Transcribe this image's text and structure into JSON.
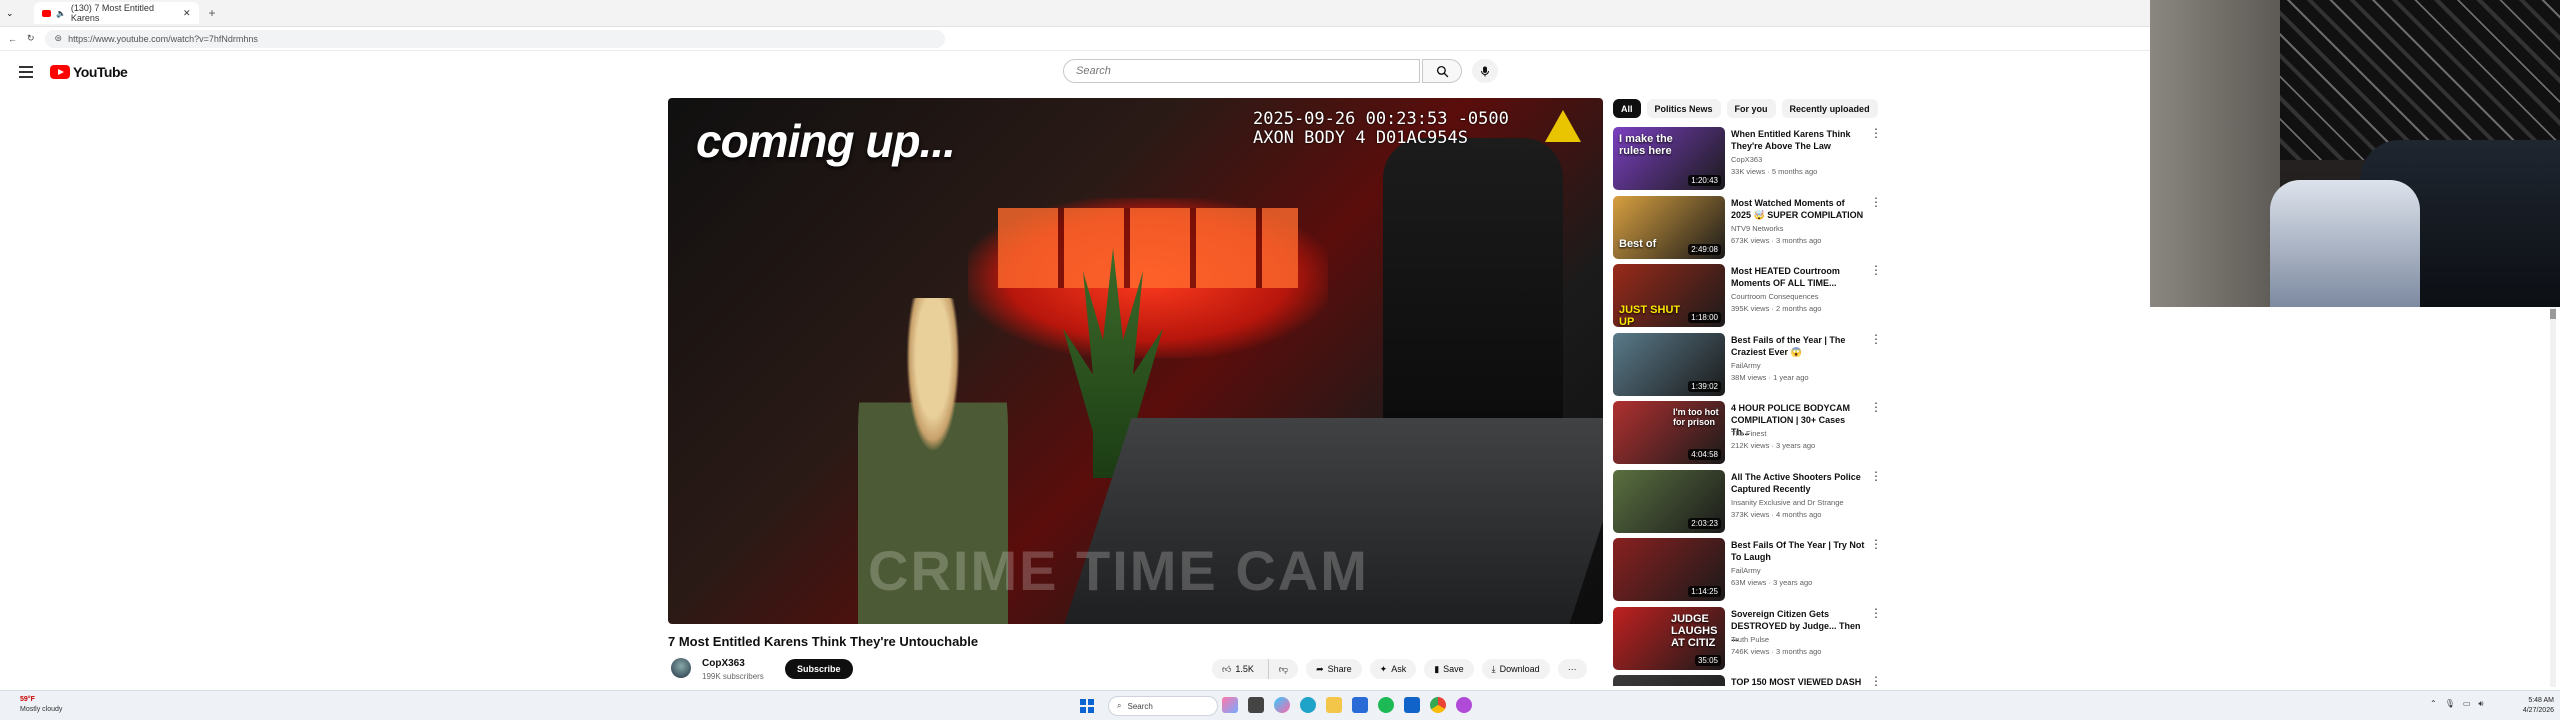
{
  "browser": {
    "tab_title": "(130) 7 Most Entitled Karens",
    "new_tab": "+",
    "url": "https://www.youtube.com/watch?v=7hfNdrmhns"
  },
  "youtube": {
    "logo_text": "YouTube",
    "search_placeholder": "Search"
  },
  "video": {
    "overlay_text": "coming up...",
    "timestamp_line1": "2025-09-26 00:23:53 -0500",
    "timestamp_line2": "AXON BODY 4 D01AC954S",
    "watermark": "CRIME TIME CAM",
    "title": "7 Most Entitled Karens Think They're Untouchable",
    "channel_name": "CopX363",
    "channel_subs": "199K subscribers",
    "subscribe_label": "Subscribe",
    "like_count": "1.5K",
    "share_label": "Share",
    "ask_label": "Ask",
    "save_label": "Save",
    "download_label": "Download",
    "more_label": "···"
  },
  "sidebar": {
    "chips": [
      {
        "label": "All"
      },
      {
        "label": "Politics News"
      },
      {
        "label": "For you"
      },
      {
        "label": "Recently uploaded"
      }
    ],
    "items": [
      {
        "title": "When Entitled Karens Think They're Above The Law",
        "channel": "CopX363",
        "meta": "33K views · 5 months ago",
        "duration": "1:20:43",
        "thumb_text": "I make the rules here",
        "color": "#7a3fc0"
      },
      {
        "title": "Most Watched Moments of 2025 🤯 SUPER COMPILATION",
        "channel": "NTV9 Networks",
        "meta": "673K views · 3 months ago",
        "duration": "2:49:08",
        "thumb_text": "Best of",
        "color": "#d8a040"
      },
      {
        "title": "Most HEATED Courtroom Moments OF ALL TIME...",
        "channel": "Courtroom Consequences",
        "meta": "395K views · 2 months ago",
        "duration": "1:18:00",
        "thumb_text": "JUST SHUT UP",
        "color": "#9a2a1a"
      },
      {
        "title": "Best Fails of the Year | The Craziest Ever 😱",
        "channel": "FailArmy",
        "meta": "38M views · 1 year ago",
        "duration": "1:39:02",
        "thumb_text": "",
        "color": "#5a7a8a"
      },
      {
        "title": "4 HOUR POLICE BODYCAM COMPILATION | 30+ Cases Th...",
        "channel": "The Finest",
        "meta": "212K views · 3 years ago",
        "duration": "4:04:58",
        "thumb_text": "I'm too hot for prison",
        "color": "#b03030"
      },
      {
        "title": "All The Active Shooters Police Captured Recently",
        "channel": "Insanity Exclusive and Dr Strange",
        "meta": "373K views · 4 months ago",
        "duration": "2:03:23",
        "thumb_text": "",
        "color": "#5a7040"
      },
      {
        "title": "Best Fails Of The Year | Try Not To Laugh",
        "channel": "FailArmy",
        "meta": "63M views · 3 years ago",
        "duration": "1:14:25",
        "thumb_text": "",
        "color": "#8a2020"
      },
      {
        "title": "Sovereign Citizen Gets DESTROYED by Judge... Then ...",
        "channel": "Truth Pulse",
        "meta": "746K views · 3 months ago",
        "duration": "35:05",
        "thumb_text": "JUDGE LAUGHS AT CITIZ",
        "color": "#c02020"
      },
      {
        "title": "TOP 150 MOST VIEWED DASH",
        "channel": "",
        "meta": "",
        "duration": "",
        "thumb_text": "",
        "color": "#3a3a3a"
      }
    ]
  },
  "taskbar": {
    "weather_temp": "59°F",
    "weather_desc": "Mostly cloudy",
    "search_label": "Search",
    "time": "5:48 AM",
    "date": "4/27/2026"
  }
}
